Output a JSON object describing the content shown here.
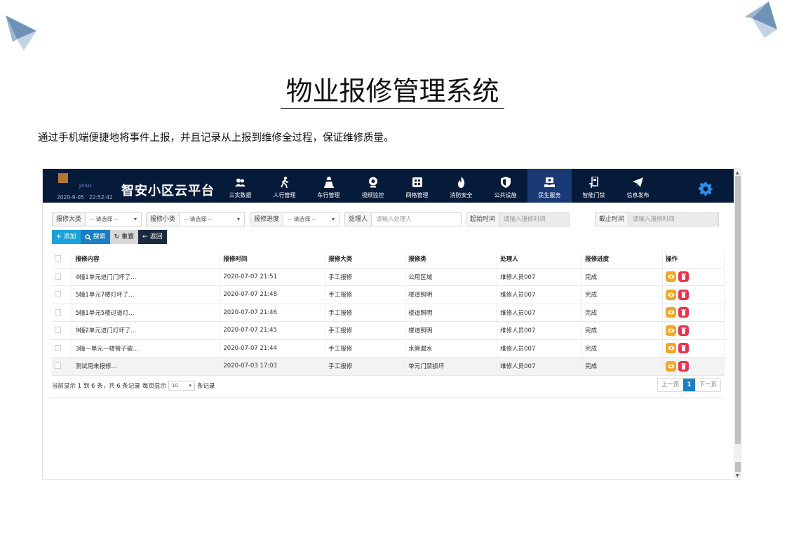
{
  "slide": {
    "title": "物业报修管理系统",
    "description": "通过手机端便捷地将事件上报，并且记录从上报到维修全过程，保证维修质量。"
  },
  "app": {
    "brand": "JASU",
    "date": "2020-9-05",
    "time": "22:52:42",
    "title": "智安小区云平台"
  },
  "nav": [
    {
      "label": "三实数据",
      "icon": "users-icon"
    },
    {
      "label": "人行管理",
      "icon": "walking-person-icon"
    },
    {
      "label": "车行管理",
      "icon": "traffic-cone-icon"
    },
    {
      "label": "视频监控",
      "icon": "camera-icon"
    },
    {
      "label": "网格管理",
      "icon": "grid-icon"
    },
    {
      "label": "消防安全",
      "icon": "fire-icon"
    },
    {
      "label": "公共设施",
      "icon": "shield-icon"
    },
    {
      "label": "民生服务",
      "icon": "service-icon"
    },
    {
      "label": "智能门禁",
      "icon": "door-access-icon"
    },
    {
      "label": "信息发布",
      "icon": "send-icon"
    }
  ],
  "active_nav": "民生服务",
  "filters": {
    "category_label": "报修大类",
    "category_value": "-- 请选择 --",
    "subcategory_label": "报修小类",
    "subcategory_value": "-- 请选择 --",
    "progress_label": "报修进度",
    "progress_value": "-- 请选择 --",
    "handler_label": "处理人",
    "handler_placeholder": "请输入处理人",
    "start_label": "起始时间",
    "start_placeholder": "请输入报修时间",
    "end_label": "截止时间",
    "end_placeholder": "请输入报修时间"
  },
  "buttons": {
    "add": "添加",
    "search": "搜索",
    "reset": "重置",
    "back": "返回"
  },
  "table": {
    "headers": [
      "报修内容",
      "报修时间",
      "报修大类",
      "报修类",
      "处理人",
      "报修进度",
      "操作"
    ],
    "rows": [
      [
        "4幢1单元进门门坏了...",
        "2020-07-07 21:51",
        "手工报修",
        "公用区域",
        "维修人员007",
        "完成"
      ],
      [
        "5幢1单元7楼灯坏了...",
        "2020-07-07 21:48",
        "手工报修",
        "楼道照明",
        "维修人员007",
        "完成"
      ],
      [
        "5幢1单元5楼过道灯...",
        "2020-07-07 21:46",
        "手工报修",
        "楼道照明",
        "维修人员007",
        "完成"
      ],
      [
        "9幢2单元进门灯坏了...",
        "2020-07-07 21:45",
        "手工报修",
        "楼道照明",
        "维修人员007",
        "完成"
      ],
      [
        "3幢一单元一楼管子破...",
        "2020-07-07 21:44",
        "手工报修",
        "水管漏水",
        "维修人员007",
        "完成"
      ],
      [
        "测试用来报修...",
        "2020-07-03 17:03",
        "手工报修",
        "单元门禁损坏",
        "维修人员007",
        "完成"
      ]
    ]
  },
  "pagination": {
    "info_prefix": "当前显示 1 到 6 条，共 6 条记录",
    "per_page_label": "每页显示",
    "per_page_value": "10",
    "per_page_suffix": "条记录",
    "prev": "上一页",
    "current": "1",
    "next": "下一页"
  },
  "colors": {
    "topbar": "#061a3a",
    "active_nav": "#1a3a75",
    "primary": "#1a7fc3",
    "view": "#f5a623",
    "delete": "#e8344c"
  }
}
